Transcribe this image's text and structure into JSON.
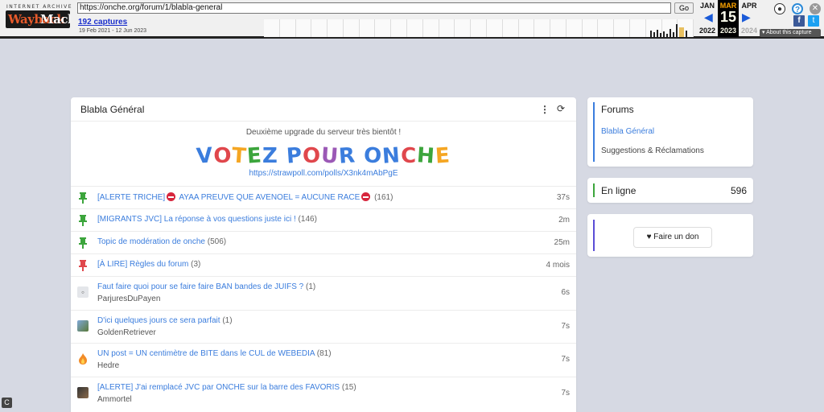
{
  "wayback": {
    "brand_top": "INTERNET ARCHIVE",
    "brand_part1": "Wayback",
    "brand_part2": "Machine",
    "url": "https://onche.org/forum/1/blabla-general",
    "go_label": "Go",
    "captures_link": "192 captures",
    "date_range": "19 Feb 2021 - 12 Jun 2023",
    "months": {
      "prev": "JAN",
      "current": "MAR",
      "next": "APR"
    },
    "day": "15",
    "years": {
      "prev": "2022",
      "current": "2023",
      "next": "2024"
    },
    "about_label": "About this capture"
  },
  "board": {
    "title": "Blabla Général",
    "notice": "Deuxième upgrade du serveur très bientôt !",
    "vote_letters": [
      {
        "ch": "V",
        "color": "#3b7ddd"
      },
      {
        "ch": "O",
        "color": "#e0474c"
      },
      {
        "ch": "T",
        "color": "#f5a623"
      },
      {
        "ch": "E",
        "color": "#3ca53c"
      },
      {
        "ch": "Z",
        "color": "#3b7ddd"
      },
      {
        "ch": " ",
        "color": "#000000"
      },
      {
        "ch": "P",
        "color": "#3b7ddd"
      },
      {
        "ch": "O",
        "color": "#e0474c"
      },
      {
        "ch": "U",
        "color": "#9b59b6"
      },
      {
        "ch": "R",
        "color": "#3b7ddd"
      },
      {
        "ch": " ",
        "color": "#000000"
      },
      {
        "ch": "O",
        "color": "#3b7ddd"
      },
      {
        "ch": "N",
        "color": "#3b7ddd"
      },
      {
        "ch": "C",
        "color": "#e0474c"
      },
      {
        "ch": "H",
        "color": "#3ca53c"
      },
      {
        "ch": "E",
        "color": "#f5a623"
      }
    ],
    "poll_link": "https://strawpoll.com/polls/X3nk4mAbPgE",
    "topics": [
      {
        "icon": "pin",
        "pin": "green",
        "title": "[ALERTE TRICHE]",
        "title2": "AYAA PREUVE QUE AVENOEL = AUCUNE RACE",
        "ban": true,
        "count": "(161)",
        "author": "",
        "time": "37s"
      },
      {
        "icon": "pin",
        "pin": "green",
        "title": "[MIGRANTS JVC] La réponse à vos questions juste ici !",
        "title2": "",
        "ban": false,
        "count": "(146)",
        "author": "",
        "time": "2m"
      },
      {
        "icon": "pin",
        "pin": "green",
        "title": "Topic de modération de onche",
        "title2": "",
        "ban": false,
        "count": "(506)",
        "author": "",
        "time": "25m"
      },
      {
        "icon": "pin",
        "pin": "red",
        "title": "[À LIRE] Règles du forum",
        "title2": "",
        "ban": false,
        "count": "(3)",
        "author": "",
        "time": "4 mois"
      },
      {
        "icon": "avatar",
        "avatar": "ghost",
        "title": "Faut faire quoi pour se faire faire BAN bandes de JUIFS ?",
        "title2": "",
        "ban": false,
        "count": "(1)",
        "author": "ParjuresDuPayen",
        "time": "6s"
      },
      {
        "icon": "avatar",
        "avatar": "photo",
        "title": "D'ici quelques jours ce sera parfait",
        "title2": "",
        "ban": false,
        "count": "(1)",
        "author": "GoldenRetriever",
        "time": "7s"
      },
      {
        "icon": "fire",
        "title": "UN post = UN centimètre de BITE dans le CUL de WEBEDIA",
        "title2": "",
        "ban": false,
        "count": "(81)",
        "author": "Hedre",
        "time": "7s"
      },
      {
        "icon": "avatar",
        "avatar": "dark",
        "title": "[ALERTE] J'ai remplacé JVC par ONCHE sur la barre des FAVORIS",
        "title2": "",
        "ban": false,
        "count": "(15)",
        "author": "Ammortel",
        "time": "7s"
      }
    ]
  },
  "sidebar": {
    "forums_title": "Forums",
    "forums": [
      "Blabla Général",
      "Suggestions & Réclamations"
    ],
    "online_label": "En ligne",
    "online_count": "596",
    "donate_label": "Faire un don"
  },
  "colors": {
    "link": "#3b7ddd",
    "pin_green": "#3ca53c",
    "pin_red": "#e0474c",
    "background": "#d6d9e3"
  }
}
